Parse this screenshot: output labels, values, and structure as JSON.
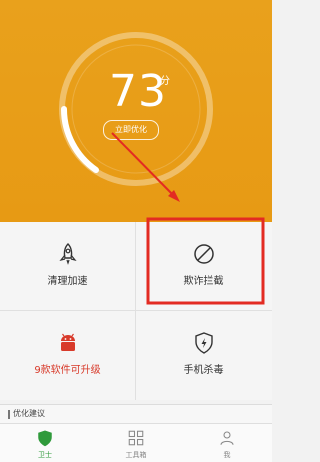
{
  "score": {
    "value": "73",
    "unit": "分",
    "progress_fraction": 0.28
  },
  "optimize_button": "立即优化",
  "grid": {
    "cleanup": "清理加速",
    "fraud_block": "欺诈拦截",
    "upgrades": "9款软件可升级",
    "antivirus": "手机杀毒"
  },
  "suggestions_title": "优化建议",
  "tabs": [
    {
      "label": "卫士",
      "icon": "shield-icon",
      "active": true
    },
    {
      "label": "工具箱",
      "icon": "grid-icon",
      "active": false
    },
    {
      "label": "我",
      "icon": "person-icon",
      "active": false
    }
  ],
  "colors": {
    "header": "#e9a11c",
    "annotation_red": "#e32b22",
    "active_tab": "#2f9a3b",
    "android_red": "#d83a2a"
  }
}
